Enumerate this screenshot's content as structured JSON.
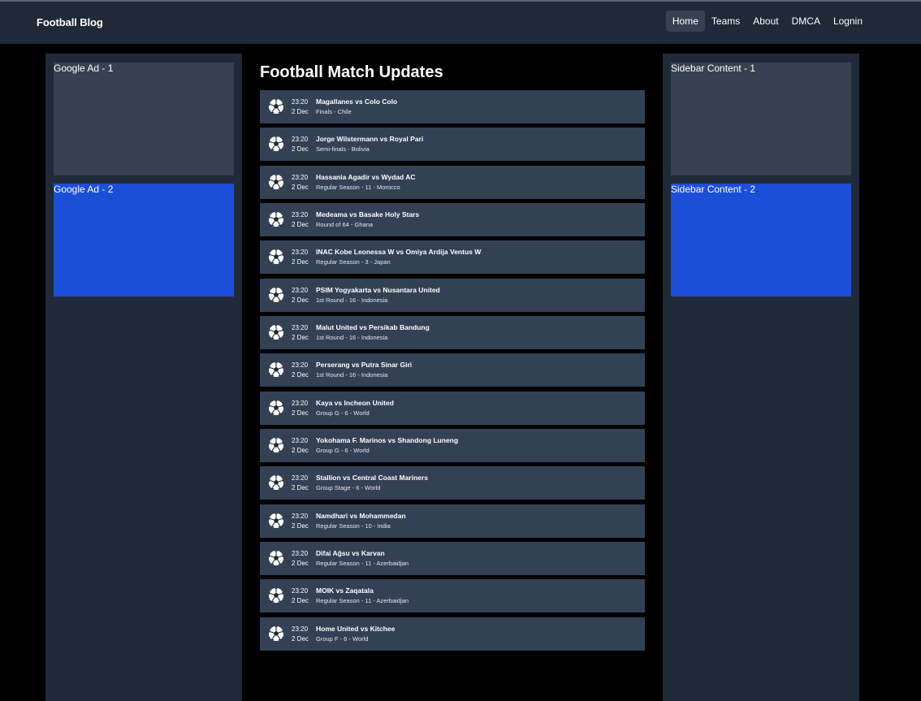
{
  "brand": "Football Blog",
  "nav": [
    "Home",
    "Teams",
    "About",
    "DMCA",
    "Lognin"
  ],
  "active_nav": "Home",
  "left_sidebar": {
    "ad1": "Google Ad - 1",
    "ad2": "Google Ad - 2"
  },
  "right_sidebar": {
    "box1": "Sidebar Content - 1",
    "box2": "Sidebar Content - 2"
  },
  "main": {
    "title": "Football Match Updates",
    "matches": [
      {
        "time": "23:20",
        "date": "2 Dec",
        "title": "Magallanes vs Colo Colo",
        "sub": "Finals - Chile"
      },
      {
        "time": "23:20",
        "date": "2 Dec",
        "title": "Jorge Wilstermann vs Royal Pari",
        "sub": "Semi-finals - Bolivia"
      },
      {
        "time": "23:20",
        "date": "2 Dec",
        "title": "Hassania Agadir vs Wydad AC",
        "sub": "Regular Season - 11 - Morocco"
      },
      {
        "time": "23:20",
        "date": "2 Dec",
        "title": "Medeama vs Basake Holy Stars",
        "sub": "Round of 64 - Ghana"
      },
      {
        "time": "23:20",
        "date": "2 Dec",
        "title": "INAC Kobe Leonessa W vs Omiya Ardija Ventus W",
        "sub": "Regular Season - 3 - Japan"
      },
      {
        "time": "23:20",
        "date": "2 Dec",
        "title": "PSIM Yogyakarta vs Nusantara United",
        "sub": "1st Round - 16 - Indonesia"
      },
      {
        "time": "23:20",
        "date": "2 Dec",
        "title": "Malut United vs Persikab Bandung",
        "sub": "1st Round - 16 - Indonesia"
      },
      {
        "time": "23:20",
        "date": "2 Dec",
        "title": "Perserang vs Putra Sinar Giri",
        "sub": "1st Round - 16 - Indonesia"
      },
      {
        "time": "23:20",
        "date": "2 Dec",
        "title": "Kaya vs Incheon United",
        "sub": "Group G - 6 - World"
      },
      {
        "time": "23:20",
        "date": "2 Dec",
        "title": "Yokohama F. Marinos vs Shandong Luneng",
        "sub": "Group G - 6 - World"
      },
      {
        "time": "23:20",
        "date": "2 Dec",
        "title": "Stallion vs Central Coast Mariners",
        "sub": "Group Stage - 6 - World"
      },
      {
        "time": "23:20",
        "date": "2 Dec",
        "title": "Namdhari vs Mohammedan",
        "sub": "Regular Season - 10 - India"
      },
      {
        "time": "23:20",
        "date": "2 Dec",
        "title": "Difai Ağsu vs Karvan",
        "sub": "Regular Season - 11 - Azerbaidjan"
      },
      {
        "time": "23:20",
        "date": "2 Dec",
        "title": "MOIK vs Zaqatala",
        "sub": "Regular Season - 11 - Azerbaidjan"
      },
      {
        "time": "23:20",
        "date": "2 Dec",
        "title": "Home United vs Kitchee",
        "sub": "Group F - 6 - World"
      }
    ]
  },
  "colors": {
    "page_bg": "#000000",
    "panel_bg": "#1f2937",
    "card_bg": "#334155",
    "ad_grey": "#374151",
    "ad_blue": "#1d4ed8"
  },
  "icons": {
    "match_icon": "soccer-ball-icon"
  }
}
